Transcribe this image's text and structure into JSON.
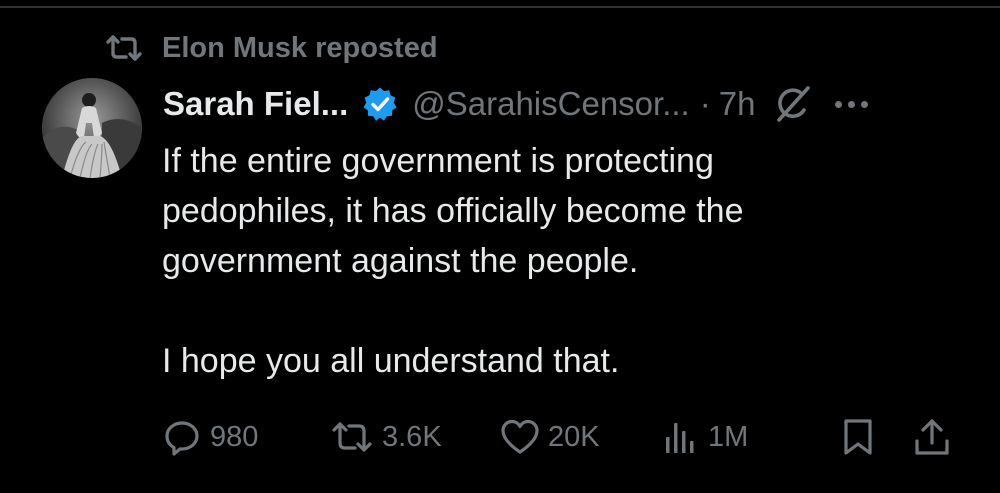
{
  "colors": {
    "background": "#000000",
    "text_primary": "#e7e9ea",
    "text_secondary": "#71767b",
    "verified_blue": "#1d9bf0",
    "divider": "#2f3336"
  },
  "repost": {
    "icon": "repost-icon",
    "label": "Elon Musk reposted"
  },
  "author": {
    "avatar_icon": "avatar",
    "display_name": "Sarah Fiel...",
    "verified_icon": "verified-badge-icon",
    "handle": "@SarahisCensor...",
    "separator": "·",
    "time": "7h"
  },
  "header_icons": {
    "grok": "grok-icon",
    "more": "more-icon"
  },
  "post": {
    "text": "If the entire government is protecting\npedophiles, it has officially become the\ngovernment against the people.\n\nI hope you all understand that."
  },
  "actions": {
    "reply": {
      "icon": "reply-icon",
      "count": "980"
    },
    "repost": {
      "icon": "repost-icon",
      "count": "3.6K"
    },
    "like": {
      "icon": "heart-icon",
      "count": "20K"
    },
    "views": {
      "icon": "views-icon",
      "count": "1M"
    },
    "bookmark": {
      "icon": "bookmark-icon"
    },
    "share": {
      "icon": "share-icon"
    }
  }
}
